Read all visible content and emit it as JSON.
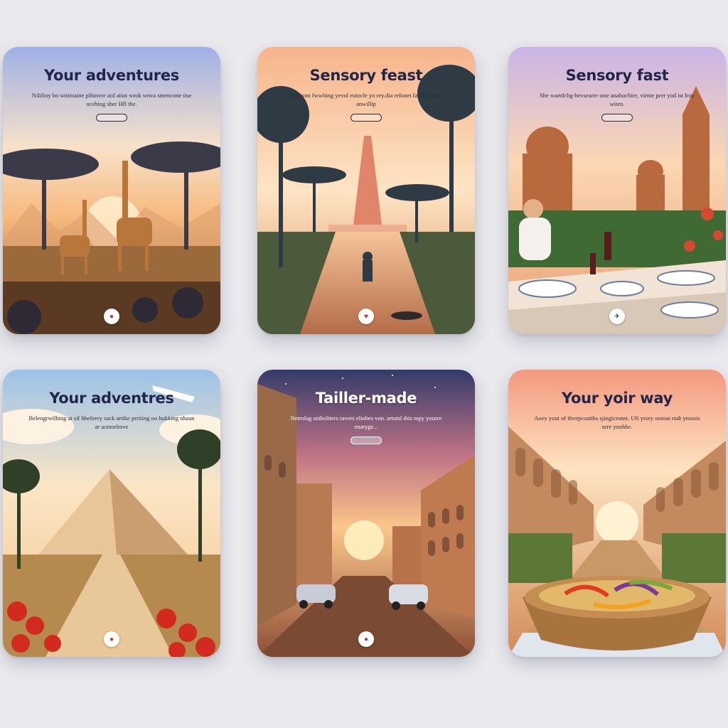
{
  "cards": [
    {
      "title": "Your adventures",
      "subtitle": "Nilifiny bo witimaine plhinvre aof atiot wrok wnva sntencone tise ucehing sher Hfl the.",
      "icon": "circle-dot-icon",
      "icon_glyph": "●"
    },
    {
      "title": "Sensory feast",
      "subtitle": "Mahiom fwwhing yevol eutocle yo rey.dia refonet fao fileunon anwillip",
      "icon": "heart-icon",
      "icon_glyph": "♥"
    },
    {
      "title": "Sensory fast",
      "subtitle": "She wartdchg-hevsearre sme anahuchire, virnte prer yod ist lroy witen.",
      "icon": "plane-icon",
      "icon_glyph": "✈"
    },
    {
      "title": "Your adventres",
      "subtitle": "Belengrwilhing at sif hhefeery sack artike prriting oo hukking nhaan ar acmorltove",
      "icon": "circle-dot-icon",
      "icon_glyph": "●"
    },
    {
      "title": "Tailler-made",
      "subtitle": "Netrolag sniholtters ravers eliobes von. artotsl this mpy yourre enaryge...",
      "icon": "circle-dot-icon",
      "icon_glyph": "●"
    },
    {
      "title": "Your yoir way",
      "subtitle": "Aoey yout of thvepcoatths sjingicronst. Ufi yrury ootoat rodt ytoosis sere yoohhe.",
      "icon": "circle-dot-icon",
      "icon_glyph": "●"
    }
  ]
}
